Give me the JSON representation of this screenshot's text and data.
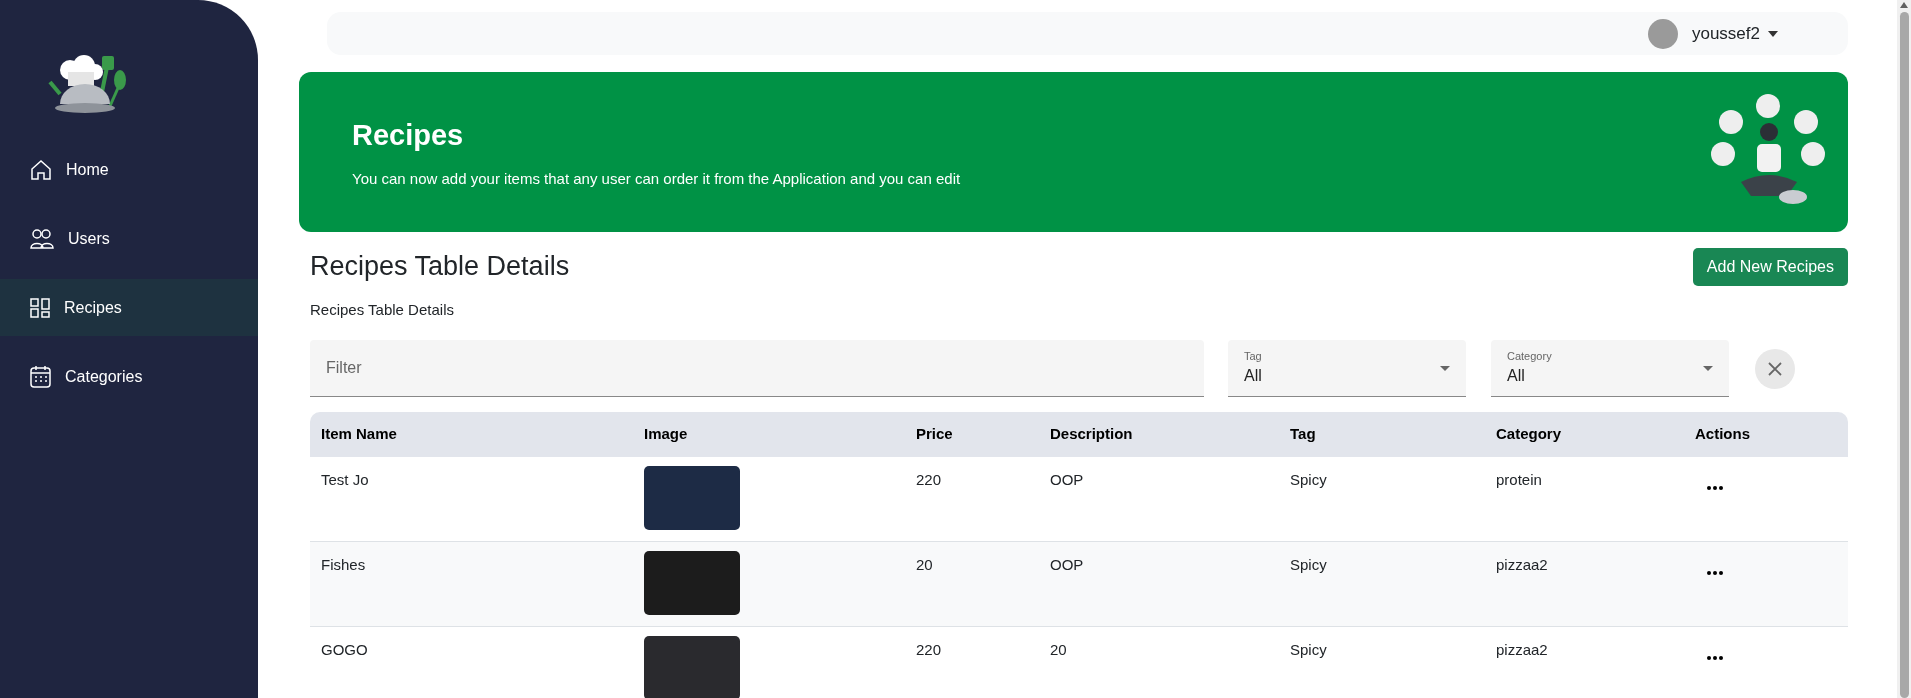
{
  "sidebar": {
    "items": [
      {
        "label": "Home",
        "selected": false
      },
      {
        "label": "Users",
        "selected": false
      },
      {
        "label": "Recipes",
        "selected": true
      },
      {
        "label": "Categories",
        "selected": false
      }
    ]
  },
  "topbar": {
    "username": "youssef2"
  },
  "banner": {
    "title": "Recipes",
    "subtitle": "You can now add your items that any user can order it from the Application and you can edit"
  },
  "section": {
    "title": "Recipes Table Details",
    "subtitle": "Recipes Table Details",
    "add_button": "Add New Recipes"
  },
  "filters": {
    "search": {
      "placeholder": "Filter"
    },
    "tag": {
      "label": "Tag",
      "value": "All"
    },
    "category": {
      "label": "Category",
      "value": "All"
    }
  },
  "table": {
    "columns": [
      "Item Name",
      "Image",
      "Price",
      "Description",
      "Tag",
      "Category",
      "Actions"
    ],
    "rows": [
      {
        "item_name": "Test Jo",
        "price": "220",
        "description": "OOP",
        "tag": "Spicy",
        "category": "protein"
      },
      {
        "item_name": "Fishes",
        "price": "20",
        "description": "OOP",
        "tag": "Spicy",
        "category": "pizzaa2"
      },
      {
        "item_name": "GOGO",
        "price": "220",
        "description": "20",
        "tag": "Spicy",
        "category": "pizzaa2"
      }
    ]
  }
}
